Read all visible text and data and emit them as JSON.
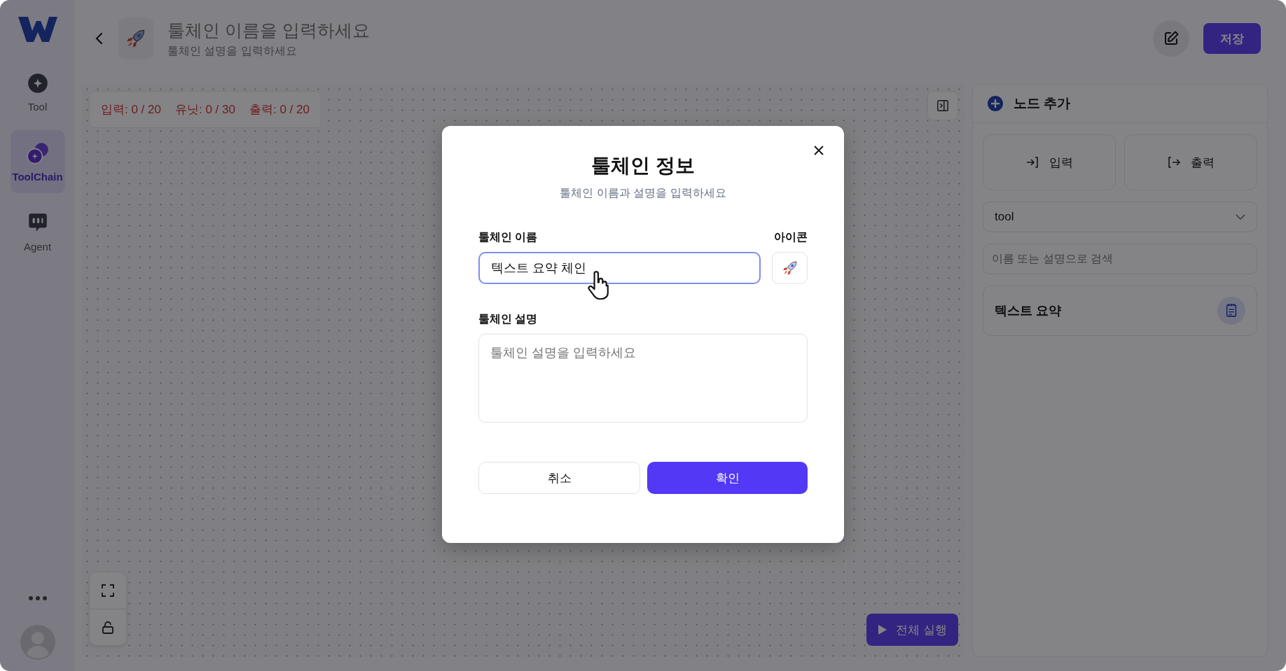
{
  "sidebar": {
    "items": [
      {
        "label": "Tool",
        "kind": "tool",
        "selected": false
      },
      {
        "label": "ToolChain",
        "kind": "chain",
        "selected": true
      },
      {
        "label": "Agent",
        "kind": "agent",
        "selected": false
      }
    ]
  },
  "header": {
    "title_placeholder": "툴체인 이름을 입력하세요",
    "description_placeholder": "툴체인 설명을 입력하세요",
    "save": "저장"
  },
  "counters": [
    "입력: 0 / 20",
    "유닛: 0 / 30",
    "출력: 0 / 20"
  ],
  "panel": {
    "title": "노드 추가",
    "buttons": [
      {
        "label": "입력",
        "kind": "in"
      },
      {
        "label": "출력",
        "kind": "out"
      }
    ],
    "select": "tool",
    "search_placeholder": "이름 또는 설명으로 검색",
    "items": [
      {
        "label": "텍스트 요약"
      }
    ]
  },
  "run": "전체 실행",
  "dialog": {
    "title": "툴체인 정보",
    "subtitle": "툴체인 이름과 설명을 입력하세요",
    "name_label": "툴체인 이름",
    "name_value": "텍스트 요약 체인",
    "icon_label": "아이콘",
    "desc_label": "툴체인 설명",
    "desc_placeholder": "툴체인 설명을 입력하세요",
    "cancel": "취소",
    "confirm": "확인"
  }
}
